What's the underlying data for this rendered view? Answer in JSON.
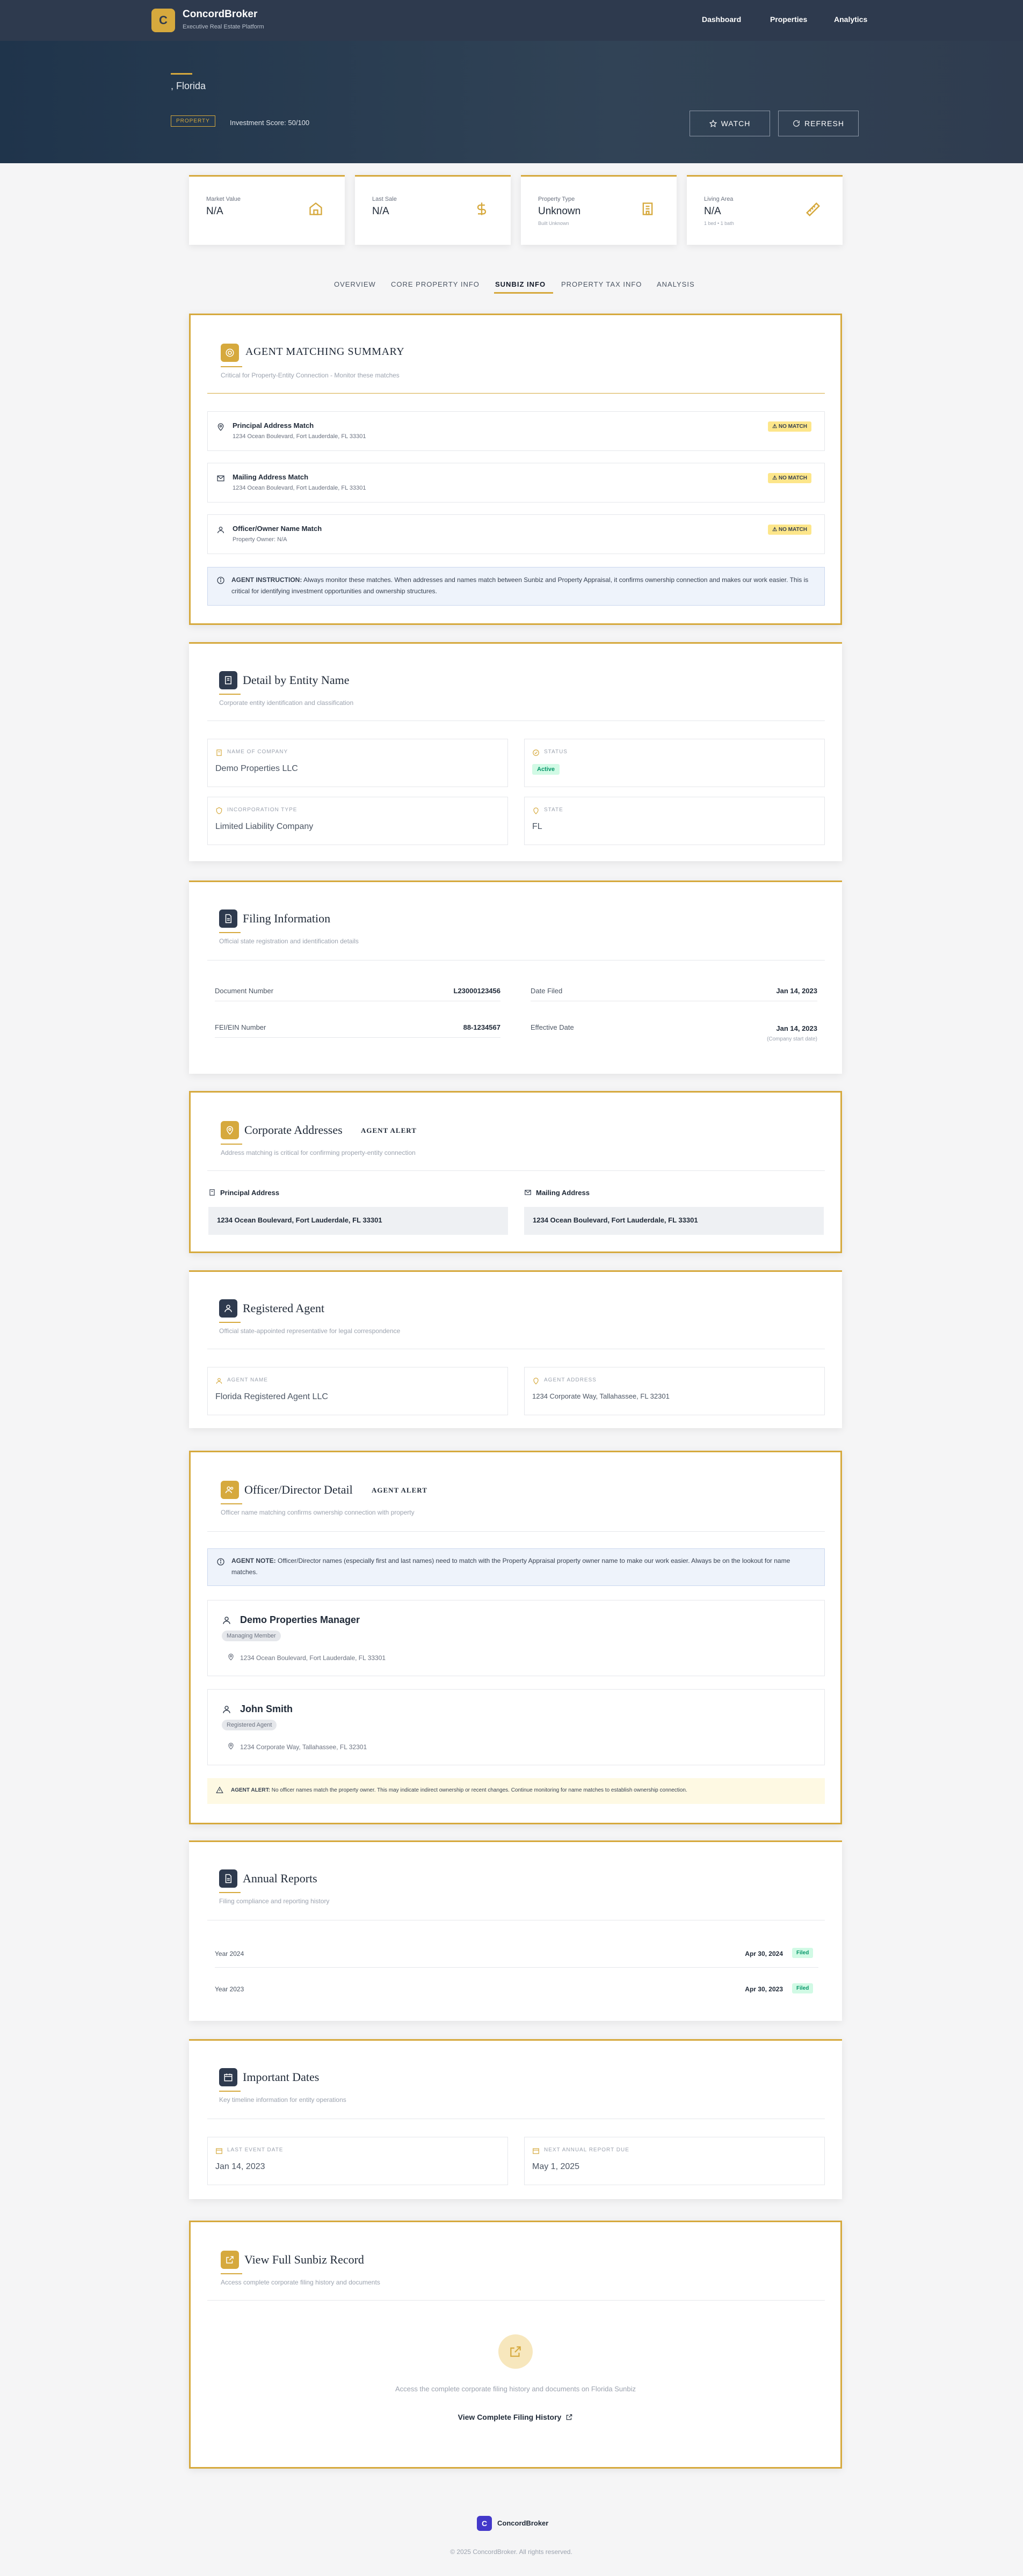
{
  "nav": {
    "brand": "ConcordBroker",
    "brand_sub": "Executive Real Estate Platform",
    "logo_letter": "C",
    "links": [
      "Dashboard",
      "Properties",
      "Analytics"
    ]
  },
  "hero": {
    "title": ", Florida",
    "badge": "PROPERTY",
    "score": "Investment Score: 50/100",
    "watch": "WATCH",
    "refresh": "REFRESH"
  },
  "stats": [
    {
      "label": "Market Value",
      "value": "N/A",
      "sub": "",
      "icon": "home-icon"
    },
    {
      "label": "Last Sale",
      "value": "N/A",
      "sub": "",
      "icon": "dollar-icon"
    },
    {
      "label": "Property Type",
      "value": "Unknown",
      "sub": "Built Unknown",
      "icon": "building-icon"
    },
    {
      "label": "Living Area",
      "value": "N/A",
      "sub": "1 bed • 1 bath",
      "icon": "ruler-icon"
    }
  ],
  "tabs": [
    "OVERVIEW",
    "CORE PROPERTY INFO",
    "SUNBIZ INFO",
    "PROPERTY TAX INFO",
    "ANALYSIS"
  ],
  "active_tab": "SUNBIZ INFO",
  "agent_matching": {
    "title": "AGENT MATCHING SUMMARY",
    "subtitle": "Critical for Property-Entity Connection - Monitor these matches",
    "rows": [
      {
        "title": "Principal Address Match",
        "sub": "1234 Ocean Boulevard, Fort Lauderdale, FL 33301",
        "status": "NO MATCH",
        "icon": "map-pin-icon"
      },
      {
        "title": "Mailing Address Match",
        "sub": "1234 Ocean Boulevard, Fort Lauderdale, FL 33301",
        "status": "NO MATCH",
        "icon": "mail-icon"
      },
      {
        "title": "Officer/Owner Name Match",
        "sub": "Property Owner: N/A",
        "status": "NO MATCH",
        "icon": "user-icon"
      }
    ],
    "instruction_label": "AGENT INSTRUCTION:",
    "instruction": "Always monitor these matches. When addresses and names match between Sunbiz and Property Appraisal, it confirms ownership connection and makes our work easier. This is critical for identifying investment opportunities and ownership structures."
  },
  "entity": {
    "title": "Detail by Entity Name",
    "subtitle": "Corporate entity identification and classification",
    "company_label": "NAME OF COMPANY",
    "company": "Demo Properties LLC",
    "status_label": "STATUS",
    "status": "Active",
    "inc_label": "INCORPORATION TYPE",
    "inc": "Limited Liability Company",
    "state_label": "STATE",
    "state": "FL"
  },
  "filing": {
    "title": "Filing Information",
    "subtitle": "Official state registration and identification details",
    "doc_label": "Document Number",
    "doc": "L23000123456",
    "date_filed_label": "Date Filed",
    "date_filed": "Jan 14, 2023",
    "fein_label": "FEI/EIN Number",
    "fein": "88-1234567",
    "eff_label": "Effective Date",
    "eff": "Jan 14, 2023",
    "eff_note": "(Company start date)"
  },
  "addresses": {
    "title": "Corporate Addresses",
    "tag": "AGENT ALERT",
    "subtitle": "Address matching is critical for confirming property-entity connection",
    "principal_label": "Principal Address",
    "principal": "1234 Ocean Boulevard, Fort Lauderdale, FL 33301",
    "mailing_label": "Mailing Address",
    "mailing": "1234 Ocean Boulevard, Fort Lauderdale, FL 33301"
  },
  "registered_agent": {
    "title": "Registered Agent",
    "subtitle": "Official state-appointed representative for legal correspondence",
    "name_label": "AGENT NAME",
    "name": "Florida Registered Agent LLC",
    "addr_label": "AGENT ADDRESS",
    "addr": "1234 Corporate Way, Tallahassee, FL 32301"
  },
  "officers": {
    "title": "Officer/Director Detail",
    "tag": "AGENT ALERT",
    "subtitle": "Officer name matching confirms ownership connection with property",
    "note_label": "AGENT NOTE:",
    "note": "Officer/Director names (especially first and last names) need to match with the Property Appraisal property owner name to make our work easier. Always be on the lookout for name matches.",
    "people": [
      {
        "name": "Demo Properties Manager",
        "role": "Managing Member",
        "addr": "1234 Ocean Boulevard, Fort Lauderdale, FL 33301"
      },
      {
        "name": "John Smith",
        "role": "Registered Agent",
        "addr": "1234 Corporate Way, Tallahassee, FL 32301"
      }
    ],
    "alert_label": "AGENT ALERT:",
    "alert": "No officer names match the property owner. This may indicate indirect ownership or recent changes. Continue monitoring for name matches to establish ownership connection."
  },
  "annual_reports": {
    "title": "Annual Reports",
    "subtitle": "Filing compliance and reporting history",
    "rows": [
      {
        "year": "Year 2024",
        "date": "Apr 30, 2024",
        "status": "Filed"
      },
      {
        "year": "Year 2023",
        "date": "Apr 30, 2023",
        "status": "Filed"
      }
    ]
  },
  "important_dates": {
    "title": "Important Dates",
    "subtitle": "Key timeline information for entity operations",
    "last_event_label": "LAST EVENT DATE",
    "last_event": "Jan 14, 2023",
    "next_report_label": "NEXT ANNUAL REPORT DUE",
    "next_report": "May 1, 2025"
  },
  "sunbiz_record": {
    "title": "View Full Sunbiz Record",
    "subtitle": "Access complete corporate filing history and documents",
    "desc": "Access the complete corporate filing history and documents on Florida Sunbiz",
    "link": "View Complete Filing History"
  },
  "footer": {
    "brand": "ConcordBroker",
    "copyright": "© 2025 ConcordBroker. All rights reserved."
  },
  "colors": {
    "gold": "#d6a93d",
    "navy": "#2e3a4e",
    "green": "#059669",
    "warning": "#fde68a"
  }
}
